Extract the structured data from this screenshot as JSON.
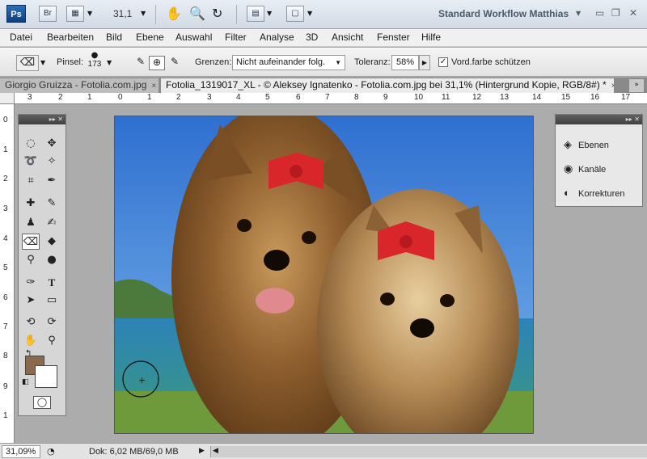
{
  "appbar": {
    "logo": "Ps",
    "bridge": "Br",
    "zoom": "31,1",
    "workspace": "Standard Workflow Matthias",
    "icons": [
      "film-icon",
      "hand-icon",
      "zoom-icon",
      "rotate-icon",
      "arrange-icon",
      "screen-mode-icon"
    ]
  },
  "menu": [
    "Datei",
    "Bearbeiten",
    "Bild",
    "Ebene",
    "Auswahl",
    "Filter",
    "Analyse",
    "3D",
    "Ansicht",
    "Fenster",
    "Hilfe"
  ],
  "options": {
    "brush_label": "Pinsel:",
    "brush_size": "173",
    "limits_label": "Grenzen:",
    "limits_value": "Nicht aufeinander folg.",
    "tolerance_label": "Toleranz:",
    "tolerance_value": "58%",
    "protect_label": "Vord.farbe schützen",
    "protect_checked": true
  },
  "tabs": [
    {
      "label": "Giorgio Gruizza - Fotolia.com.jpg",
      "close": "×"
    },
    {
      "label": "Fotolia_1319017_XL - © Aleksey Ignatenko - Fotolia.com.jpg bei 31,1% (Hintergrund Kopie, RGB/8#) *",
      "close": "×"
    }
  ],
  "rulers": {
    "h": [
      "3",
      "2",
      "1",
      "0",
      "1",
      "2",
      "3",
      "4",
      "5",
      "6",
      "7",
      "8",
      "9",
      "10",
      "11",
      "12",
      "13",
      "14",
      "15",
      "16",
      "17"
    ],
    "v": [
      "0",
      "1",
      "2",
      "3",
      "4",
      "5",
      "6",
      "7",
      "8",
      "9",
      "1"
    ]
  },
  "panel": {
    "items": [
      {
        "label": "Ebenen",
        "icon": "layers-icon"
      },
      {
        "label": "Kanäle",
        "icon": "channels-icon"
      },
      {
        "label": "Korrekturen",
        "icon": "adjustments-icon"
      }
    ]
  },
  "colors": {
    "foreground": "#8a6a4c",
    "background": "#ffffff"
  },
  "status": {
    "zoom": "31,09%",
    "doc": "Dok: 6,02 MB/69,0 MB"
  }
}
